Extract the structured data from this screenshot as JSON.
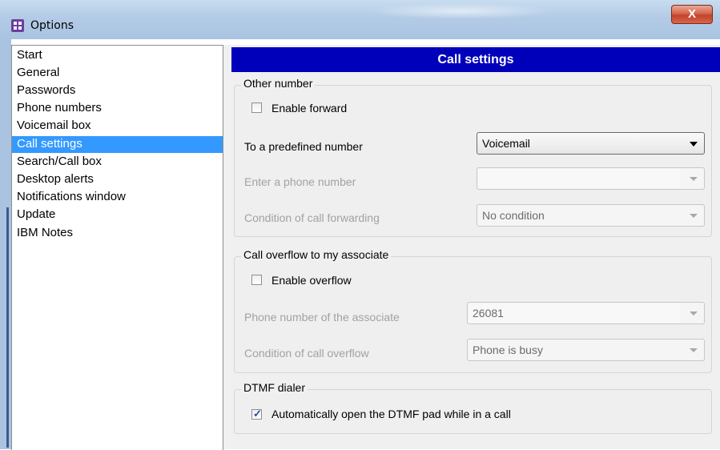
{
  "window": {
    "title": "Options",
    "close_label": "X"
  },
  "nav": {
    "items": [
      {
        "label": "Start"
      },
      {
        "label": "General"
      },
      {
        "label": "Passwords"
      },
      {
        "label": "Phone numbers"
      },
      {
        "label": "Voicemail box"
      },
      {
        "label": "Call settings",
        "selected": true
      },
      {
        "label": "Search/Call box"
      },
      {
        "label": "Desktop alerts"
      },
      {
        "label": "Notifications window"
      },
      {
        "label": "Update"
      },
      {
        "label": "IBM Notes"
      }
    ]
  },
  "panel": {
    "title": "Call settings"
  },
  "other_number": {
    "legend": "Other number",
    "enable_forward_label": "Enable forward",
    "enable_forward_checked": false,
    "predefined_label": "To a predefined number",
    "predefined_value": "Voicemail",
    "phone_label": "Enter a phone number",
    "phone_value": "",
    "condition_label": "Condition of call forwarding",
    "condition_value": "No condition"
  },
  "overflow": {
    "legend": "Call overflow to my associate",
    "enable_overflow_label": "Enable overflow",
    "enable_overflow_checked": false,
    "associate_label": "Phone number of the associate",
    "associate_value": "26081",
    "condition_label": "Condition of call overflow",
    "condition_value": "Phone is busy"
  },
  "dtmf": {
    "legend": "DTMF dialer",
    "auto_open_label": "Automatically open the DTMF pad while in a call",
    "auto_open_checked": true,
    "check_glyph": "✓"
  },
  "colors": {
    "header_bg": "#0000bb",
    "selection": "#3399ff",
    "disabled_text": "#a2a2a2"
  }
}
